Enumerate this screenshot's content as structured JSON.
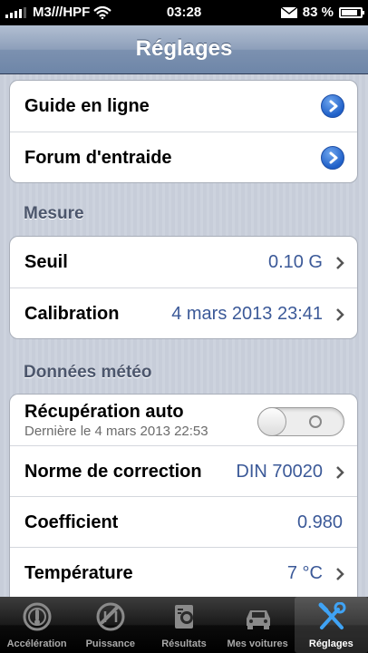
{
  "status_bar": {
    "carrier": "M3///HPF",
    "time": "03:28",
    "battery": "83 %",
    "battery_level": 0.83
  },
  "nav": {
    "title": "Réglages"
  },
  "links": [
    {
      "label": "Guide en ligne"
    },
    {
      "label": "Forum d'entraide"
    }
  ],
  "mesure": {
    "header": "Mesure",
    "seuil_label": "Seuil",
    "seuil_value": "0.10 G",
    "calibration_label": "Calibration",
    "calibration_value": "4 mars 2013 23:41"
  },
  "meteo": {
    "header": "Données météo",
    "recup_label": "Récupération auto",
    "recup_sub": "Dernière le 4 mars 2013 22:53",
    "recup_on": false,
    "norme_label": "Norme de correction",
    "norme_value": "DIN 70020",
    "coef_label": "Coefficient",
    "coef_value": "0.980",
    "temp_label": "Température",
    "temp_value": "7 °C"
  },
  "tabs": [
    {
      "label": "Accélération",
      "icon": "speedometer-icon"
    },
    {
      "label": "Puissance",
      "icon": "gauge-icon"
    },
    {
      "label": "Résultats",
      "icon": "stopwatch-icon"
    },
    {
      "label": "Mes voitures",
      "icon": "car-icon"
    },
    {
      "label": "Réglages",
      "icon": "tools-icon",
      "active": true
    }
  ],
  "colors": {
    "accent_value": "#3b5998",
    "nav_bar": "#7c91b0"
  }
}
